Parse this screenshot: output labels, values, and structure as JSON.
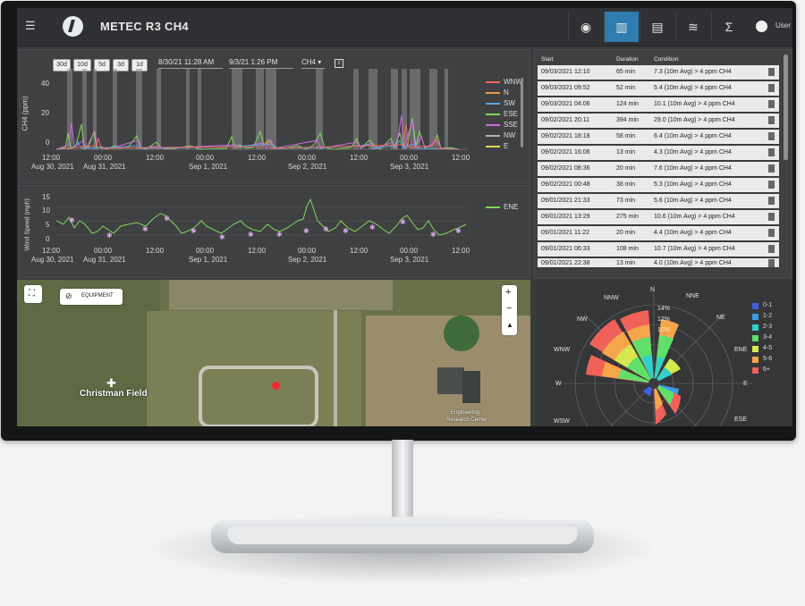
{
  "header": {
    "title": "METEC R3 CH4",
    "user_label": "User",
    "nav_icons": [
      "gauge-icon",
      "chart-icon",
      "printer-icon",
      "list-icon",
      "sigma-icon"
    ]
  },
  "ch4_chart": {
    "range_buttons": [
      "30d",
      "10d",
      "5d",
      "3d",
      "1d"
    ],
    "start_datetime": "8/30/21 11:28 AM",
    "end_datetime": "9/3/21 1:26 PM",
    "species": "CH4",
    "ylabel": "CH4 (ppm)",
    "y_ticks": [
      "40",
      "20",
      "0"
    ],
    "x_ticks": [
      "12:00",
      "00:00",
      "12:00",
      "00:00",
      "12:00",
      "00:00",
      "12:00",
      "00:00",
      "12:00"
    ],
    "date_ticks": [
      "Aug 30, 2021",
      "Aug 31, 2021",
      "Sep 1, 2021",
      "Sep 2, 2021",
      "Sep 3, 2021"
    ],
    "legend": [
      "WNW",
      "N",
      "SW",
      "ESE",
      "SSE",
      "NW",
      "E"
    ]
  },
  "wind_chart": {
    "ylabel": "Wind Speed (mph)",
    "y_ticks": [
      "15",
      "10",
      "5",
      "0"
    ],
    "x_ticks": [
      "12:00",
      "00:00",
      "12:00",
      "00:00",
      "12:00",
      "00:00",
      "12:00",
      "00:00",
      "12:00"
    ],
    "date_ticks": [
      "Aug 30, 2021",
      "Aug 31, 2021",
      "Sep 1, 2021",
      "Sep 2, 2021",
      "Sep 3, 2021"
    ],
    "legend": [
      "ENE"
    ]
  },
  "events_table": {
    "headers": [
      "Start",
      "Duration",
      "Condition"
    ],
    "rows": [
      [
        "09/03/2021 12:10",
        "65 min",
        "7.3 (10m Avg) > 4 ppm CH4"
      ],
      [
        "09/03/2021 09:52",
        "52 min",
        "5.4 (10m Avg) > 4 ppm CH4"
      ],
      [
        "09/03/2021 04:06",
        "124 min",
        "10.1 (10m Avg) > 4 ppm CH4"
      ],
      [
        "09/02/2021 20:11",
        "394 min",
        "29.0 (10m Avg) > 4 ppm CH4"
      ],
      [
        "09/02/2021 18:18",
        "58 min",
        "6.4 (10m Avg) > 4 ppm CH4"
      ],
      [
        "09/02/2021 16:06",
        "13 min",
        "4.3 (10m Avg) > 4 ppm CH4"
      ],
      [
        "09/02/2021 08:36",
        "20 min",
        "7.6 (10m Avg) > 4 ppm CH4"
      ],
      [
        "09/02/2021 00:48",
        "38 min",
        "5.3 (10m Avg) > 4 ppm CH4"
      ],
      [
        "09/01/2021 21:33",
        "73 min",
        "5.6 (10m Avg) > 4 ppm CH4"
      ],
      [
        "09/01/2021 13:29",
        "275 min",
        "10.6 (10m Avg) > 4 ppm CH4"
      ],
      [
        "09/01/2021 11:22",
        "20 min",
        "4.4 (10m Avg) > 4 ppm CH4"
      ],
      [
        "09/01/2021 06:33",
        "108 min",
        "10.7 (10m Avg) > 4 ppm CH4"
      ],
      [
        "09/01/2021 22:38",
        "13 min",
        "4.0 (10m Avg) > 4 ppm CH4"
      ]
    ]
  },
  "map": {
    "equipment_button": "EQUIPMENT",
    "labels": [
      "Christman Field",
      "Engineering",
      "Research Center"
    ]
  },
  "wind_rose": {
    "directions": [
      "N",
      "NNE",
      "NE",
      "ENE",
      "E",
      "ESE",
      "W",
      "WNW",
      "NW",
      "NNW",
      "WSW"
    ],
    "rings": [
      "14%",
      "12%",
      "10%"
    ],
    "legend": [
      {
        "label": "0-1",
        "color": "#3f5fe0"
      },
      {
        "label": "1-2",
        "color": "#3c9ce6"
      },
      {
        "label": "2-3",
        "color": "#32d0c8"
      },
      {
        "label": "3-4",
        "color": "#5ee06a"
      },
      {
        "label": "4-5",
        "color": "#d6e84e"
      },
      {
        "label": "5-6",
        "color": "#f6a64a"
      },
      {
        "label": "6+",
        "color": "#f0615a"
      }
    ]
  }
}
